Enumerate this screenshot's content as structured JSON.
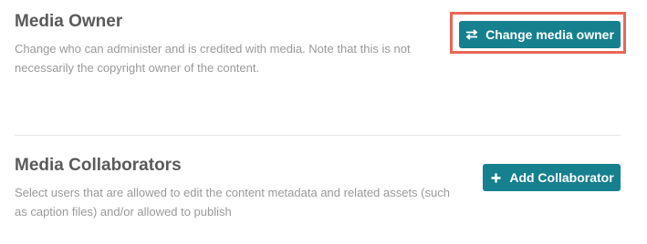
{
  "media_owner": {
    "title": "Media Owner",
    "description": "Change who can administer and is credited with media. Note that this is not necessarily the copyright owner of the content.",
    "button": {
      "label": "Change media owner",
      "icon": "swap-arrows-icon"
    },
    "highlight_color": "#e96654"
  },
  "media_collaborators": {
    "title": "Media Collaborators",
    "description": "Select users that are allowed to edit the content metadata and related assets (such as caption files) and/or allowed to publish",
    "button": {
      "label": "Add Collaborator",
      "icon": "plus-icon"
    }
  },
  "colors": {
    "button_bg": "#16808f",
    "title_text": "#5a5a5a",
    "description_text": "#999999"
  }
}
